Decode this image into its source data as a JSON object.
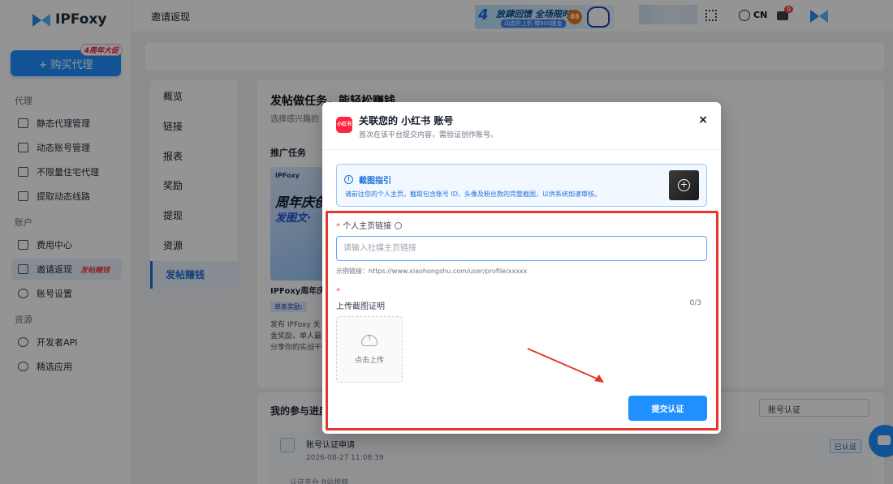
{
  "brand": {
    "name": "IPFoxy"
  },
  "sidebar": {
    "buy_label": "+ 购买代理",
    "buy_badge": "4周年大促",
    "section_proxy": "代理",
    "section_account": "账户",
    "section_resource": "资源",
    "items": [
      {
        "label": "静态代理管理",
        "icon": "monitor-icon"
      },
      {
        "label": "动态账号管理",
        "icon": "sliders-icon"
      },
      {
        "label": "不限量住宅代理",
        "icon": "infinity-icon"
      },
      {
        "label": "提取动态线路",
        "icon": "list-icon"
      },
      {
        "label": "费用中心",
        "icon": "wallet-icon"
      },
      {
        "label": "邀请返现",
        "icon": "gift-icon",
        "hot": "发帖赚钱",
        "active": true
      },
      {
        "label": "账号设置",
        "icon": "user-icon"
      },
      {
        "label": "开发者API",
        "icon": "api-icon"
      },
      {
        "label": "精选应用",
        "icon": "apps-icon"
      }
    ]
  },
  "header": {
    "title": "邀请返现",
    "banner_num": "4",
    "banner_main": "放肆回馈 全场限时",
    "banner_sub": "动态折上折 赠900搬金",
    "banner_badge": "88",
    "lang": "CN",
    "msg_count": "9"
  },
  "subnav": [
    "概览",
    "链接",
    "报表",
    "奖励",
    "提现",
    "资源",
    "发帖赚钱"
  ],
  "main": {
    "title": "发帖做任务，能轻松赚钱",
    "desc": "选择感兴趣的",
    "promo_label": "推广任务",
    "promo_brand": "IPFoxy",
    "promo_big": "周年庆创",
    "promo_big2": "发图文·",
    "promo_name": "IPFoxy周年庆创",
    "promo_tag": "单条奖励:",
    "promo_body": "发布 IPFoxy 关 金奖励，单人最 分享你的实战干"
  },
  "progress": {
    "title": "我的参与进度",
    "filter": "账号认证",
    "record_name": "账号认证申请",
    "record_time": "2026-08-27 11:08:39",
    "record_badge": "已认证",
    "record_platform": "认证平台  B站视频"
  },
  "modal": {
    "logo_text": "小红书",
    "title": "关联您的 小红书 账号",
    "subtitle": "首次在该平台提交内容，需验证创作账号。",
    "close": "×",
    "guide_title": "截图指引",
    "guide_text": "请前往您的个人主页，截取包含账号 ID、头像及粉丝数的完整截图，以供系统加速审核。",
    "field_label": "个人主页链接",
    "field_placeholder": "请输入社媒主页链接",
    "example": "示例链接：https://www.xiaohongshu.com/user/profile/xxxxx",
    "upload_label": "上传截图证明",
    "upload_count": "0/3",
    "upload_text": "点击上传",
    "submit": "提交认证"
  },
  "colors": {
    "accent": "#1e90ff",
    "highlight_frame": "#e5382b",
    "xhs_red": "#ff2442"
  }
}
